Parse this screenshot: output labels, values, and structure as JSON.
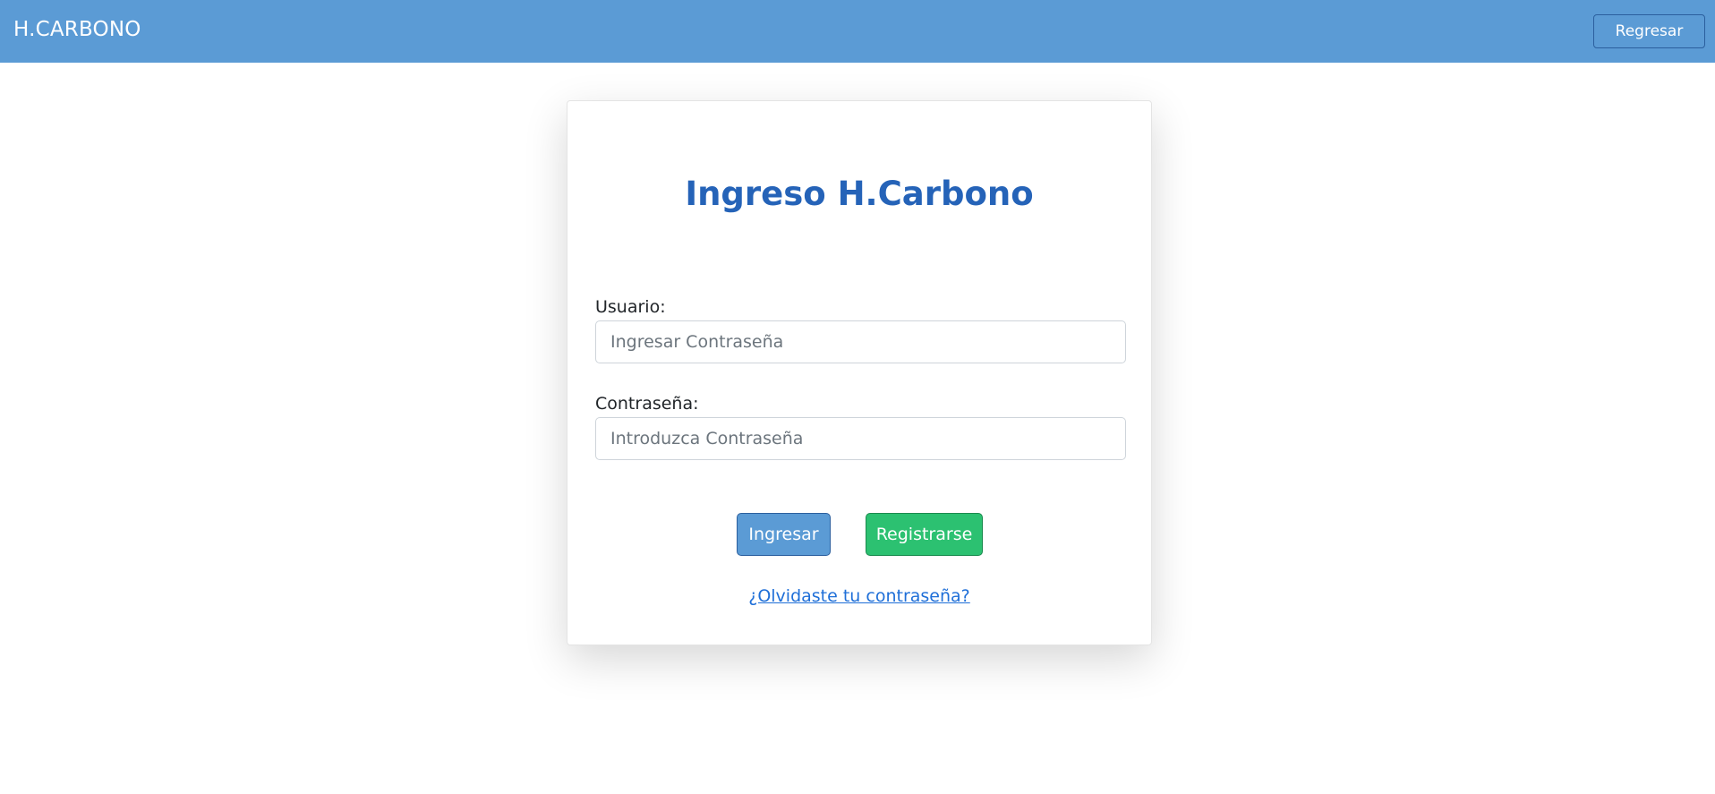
{
  "navbar": {
    "brand": "H.CARBONO",
    "back_label": "Regresar"
  },
  "login": {
    "title": "Ingreso H.Carbono",
    "user_label": "Usuario:",
    "user_placeholder": "Ingresar Contraseña",
    "password_label": "Contraseña:",
    "password_placeholder": "Introduzca Contraseña",
    "login_label": "Ingresar",
    "register_label": "Registrarse",
    "forgot_label": "¿Olvidaste tu contraseña?"
  },
  "colors": {
    "navbar": "#5b9bd5",
    "title": "#2563b8",
    "primary_button": "#5b9bd5",
    "success_button": "#2cc171",
    "link": "#1f6fd8"
  }
}
